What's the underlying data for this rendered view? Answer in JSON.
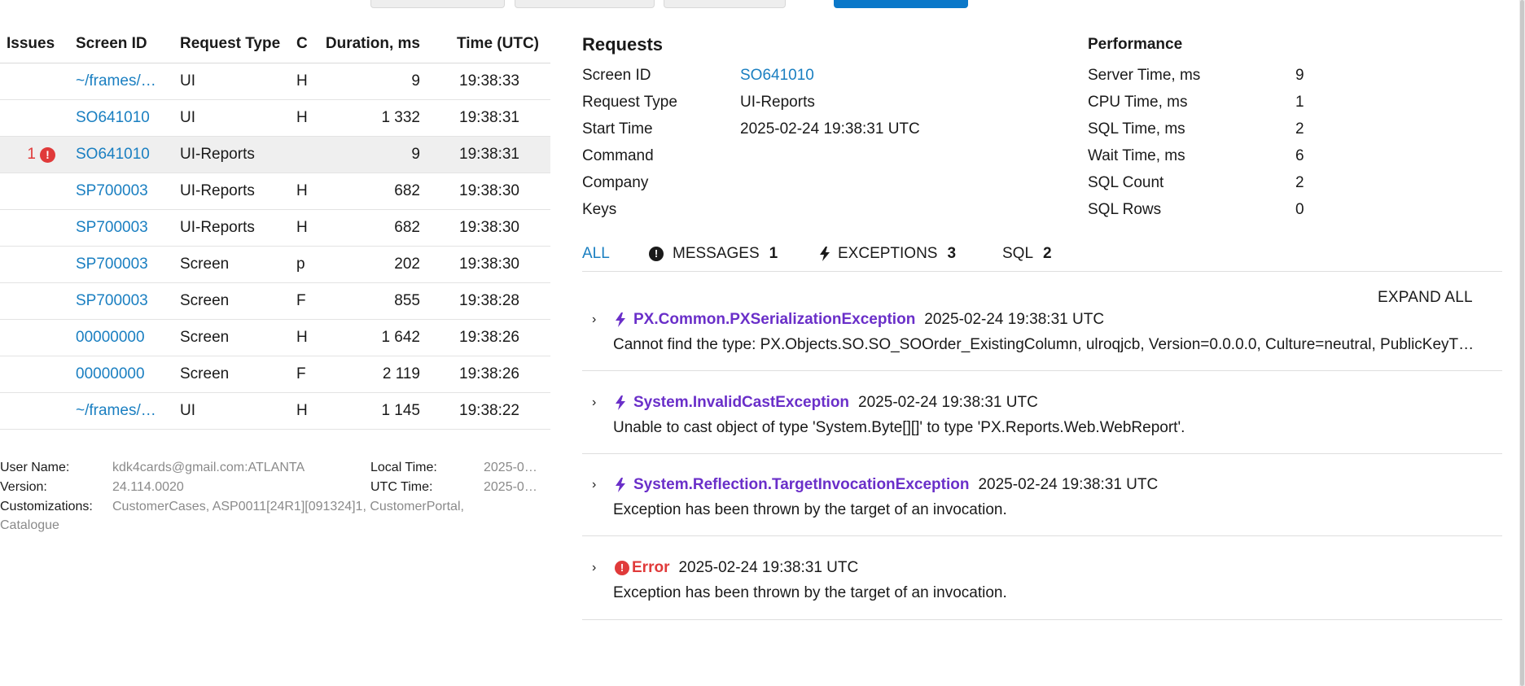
{
  "table": {
    "headers": {
      "issues": "Issues",
      "screen_id": "Screen ID",
      "request_type": "Request Type",
      "command": "C",
      "duration": "Duration, ms",
      "time": "Time (UTC)"
    },
    "rows": [
      {
        "issues": "",
        "screen_id": "~/frames/…",
        "request_type": "UI",
        "command": "H",
        "duration": "9",
        "time": "19:38:33",
        "selected": false
      },
      {
        "issues": "",
        "screen_id": "SO641010",
        "request_type": "UI",
        "command": "H",
        "duration": "1 332",
        "time": "19:38:31",
        "selected": false
      },
      {
        "issues": "1",
        "screen_id": "SO641010",
        "request_type": "UI-Reports",
        "command": "",
        "duration": "9",
        "time": "19:38:31",
        "selected": true
      },
      {
        "issues": "",
        "screen_id": "SP700003",
        "request_type": "UI-Reports",
        "command": "H",
        "duration": "682",
        "time": "19:38:30",
        "selected": false
      },
      {
        "issues": "",
        "screen_id": "SP700003",
        "request_type": "UI-Reports",
        "command": "H",
        "duration": "682",
        "time": "19:38:30",
        "selected": false
      },
      {
        "issues": "",
        "screen_id": "SP700003",
        "request_type": "Screen",
        "command": "p",
        "duration": "202",
        "time": "19:38:30",
        "selected": false
      },
      {
        "issues": "",
        "screen_id": "SP700003",
        "request_type": "Screen",
        "command": "F",
        "duration": "855",
        "time": "19:38:28",
        "selected": false
      },
      {
        "issues": "",
        "screen_id": "00000000",
        "request_type": "Screen",
        "command": "H",
        "duration": "1 642",
        "time": "19:38:26",
        "selected": false
      },
      {
        "issues": "",
        "screen_id": "00000000",
        "request_type": "Screen",
        "command": "F",
        "duration": "2 119",
        "time": "19:38:26",
        "selected": false
      },
      {
        "issues": "",
        "screen_id": "~/frames/…",
        "request_type": "UI",
        "command": "H",
        "duration": "1 145",
        "time": "19:38:22",
        "selected": false
      }
    ]
  },
  "info": {
    "user_name_label": "User Name:",
    "user_name": "kdk4cards@gmail.com:ATLANTA",
    "version_label": "Version:",
    "version": "24.114.0020",
    "customizations_label": "Customizations:",
    "customizations": "CustomerCases, ASP0011[24R1][091324]1, CustomerPortal,",
    "customizations_cont": "Catalogue",
    "local_time_label": "Local Time:",
    "local_time": "2025-0…",
    "utc_time_label": "UTC Time:",
    "utc_time": "2025-0…"
  },
  "requests": {
    "title": "Requests",
    "screen_id_label": "Screen ID",
    "screen_id": "SO641010",
    "request_type_label": "Request Type",
    "request_type": "UI-Reports",
    "start_time_label": "Start Time",
    "start_time": "2025-02-24 19:38:31 UTC",
    "command_label": "Command",
    "company_label": "Company",
    "keys_label": "Keys"
  },
  "performance": {
    "title": "Performance",
    "server_time_label": "Server Time, ms",
    "server_time": "9",
    "cpu_time_label": "CPU Time, ms",
    "cpu_time": "1",
    "sql_time_label": "SQL Time, ms",
    "sql_time": "2",
    "wait_time_label": "Wait Time, ms",
    "wait_time": "6",
    "sql_count_label": "SQL Count",
    "sql_count": "2",
    "sql_rows_label": "SQL Rows",
    "sql_rows": "0"
  },
  "tabs": {
    "all": "ALL",
    "messages": "MESSAGES",
    "messages_count": "1",
    "exceptions": "EXCEPTIONS",
    "exceptions_count": "3",
    "sql": "SQL",
    "sql_count": "2"
  },
  "expand_all": "EXPAND ALL",
  "messages": [
    {
      "kind": "exception",
      "name": "PX.Common.PXSerializationException",
      "time": "2025-02-24 19:38:31 UTC",
      "text": "Cannot find the type: PX.Objects.SO.SO_SOOrder_ExistingColumn, ulroqjcb, Version=0.0.0.0, Culture=neutral, PublicKeyT…"
    },
    {
      "kind": "exception",
      "name": "System.InvalidCastException",
      "time": "2025-02-24 19:38:31 UTC",
      "text": "Unable to cast object of type 'System.Byte[][]' to type 'PX.Reports.Web.WebReport'."
    },
    {
      "kind": "exception",
      "name": "System.Reflection.TargetInvocationException",
      "time": "2025-02-24 19:38:31 UTC",
      "text": "Exception has been thrown by the target of an invocation."
    },
    {
      "kind": "error",
      "name": "Error",
      "time": "2025-02-24 19:38:31 UTC",
      "text": "Exception has been thrown by the target of an invocation."
    }
  ],
  "colors": {
    "link": "#1a7fc1",
    "exception": "#6a2fc9",
    "error": "#e03a3a",
    "primary_button": "#0b78c9"
  },
  "icons": {
    "issue": "exclamation-circle-icon",
    "exception": "lightning-bolt-icon",
    "expand": "chevron-right-icon"
  }
}
